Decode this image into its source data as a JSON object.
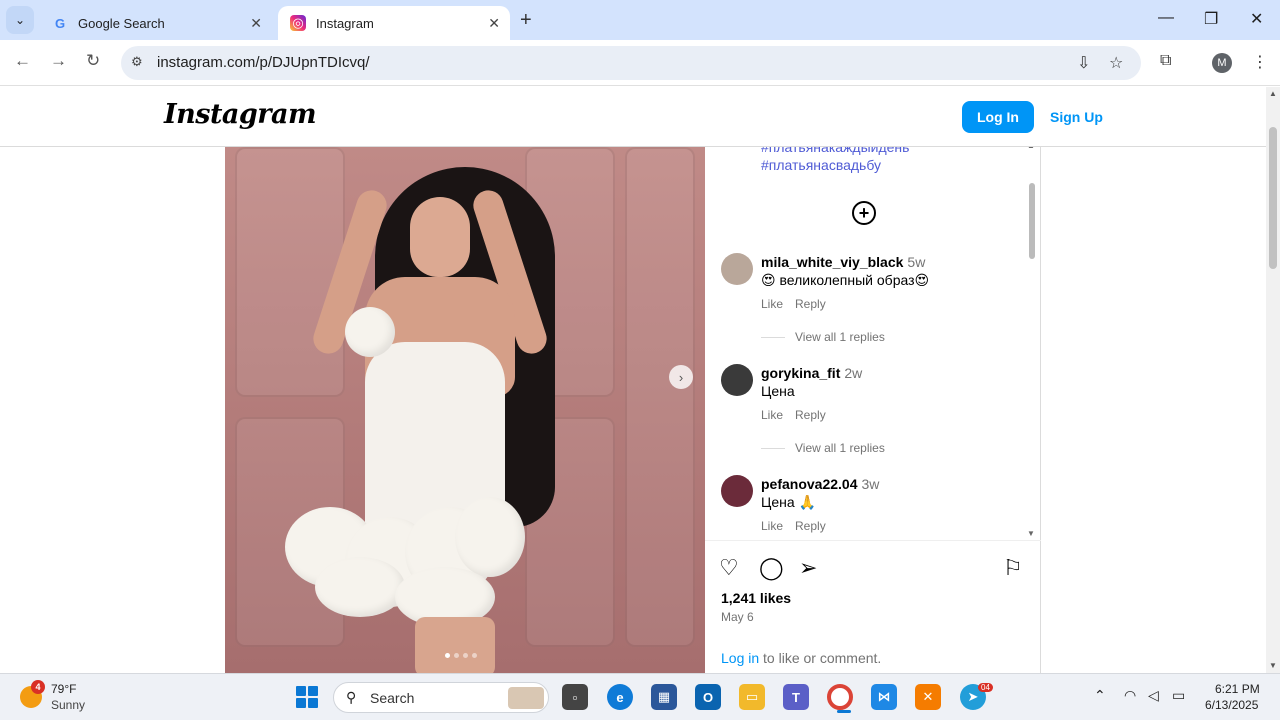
{
  "browser": {
    "tabs": [
      {
        "title": "Google Search",
        "icon": "google-icon"
      },
      {
        "title": "Instagram",
        "icon": "instagram-icon",
        "active": true
      }
    ],
    "url": "instagram.com/p/DJUpnTDIcvq/",
    "profile_initial": "M"
  },
  "instagram": {
    "logo": "Instagram",
    "login_label": "Log In",
    "signup_label": "Sign Up",
    "hashtags": [
      "#платьянакаждыйдень",
      "#платьянасвадьбу"
    ],
    "comments": [
      {
        "user": "mila_white_viy_black",
        "time": "5w",
        "text": "великолепный образ",
        "emoji_before": "😍",
        "emoji_after": "😍",
        "like": "Like",
        "reply": "Reply",
        "replies": "View all 1 replies"
      },
      {
        "user": "gorykina_fit",
        "time": "2w",
        "text": "Цена",
        "like": "Like",
        "reply": "Reply",
        "replies": "View all 1 replies"
      },
      {
        "user": "pefanova22.04",
        "time": "3w",
        "text": "Цена",
        "emoji_after": "🙏",
        "like": "Like",
        "reply": "Reply"
      }
    ],
    "likes": "1,241 likes",
    "date": "May 6",
    "login_prompt_link": "Log in",
    "login_prompt_rest": " to like or comment."
  },
  "taskbar": {
    "weather_temp": "79°F",
    "weather_desc": "Sunny",
    "weather_badge": "4",
    "search_placeholder": "Search",
    "telegram_badge": "04",
    "time": "6:21 PM",
    "date": "6/13/2025"
  },
  "colors": {
    "ig_blue": "#0095f6",
    "hashtag": "#4f5bd5",
    "tabstrip": "#d3e3fd"
  }
}
